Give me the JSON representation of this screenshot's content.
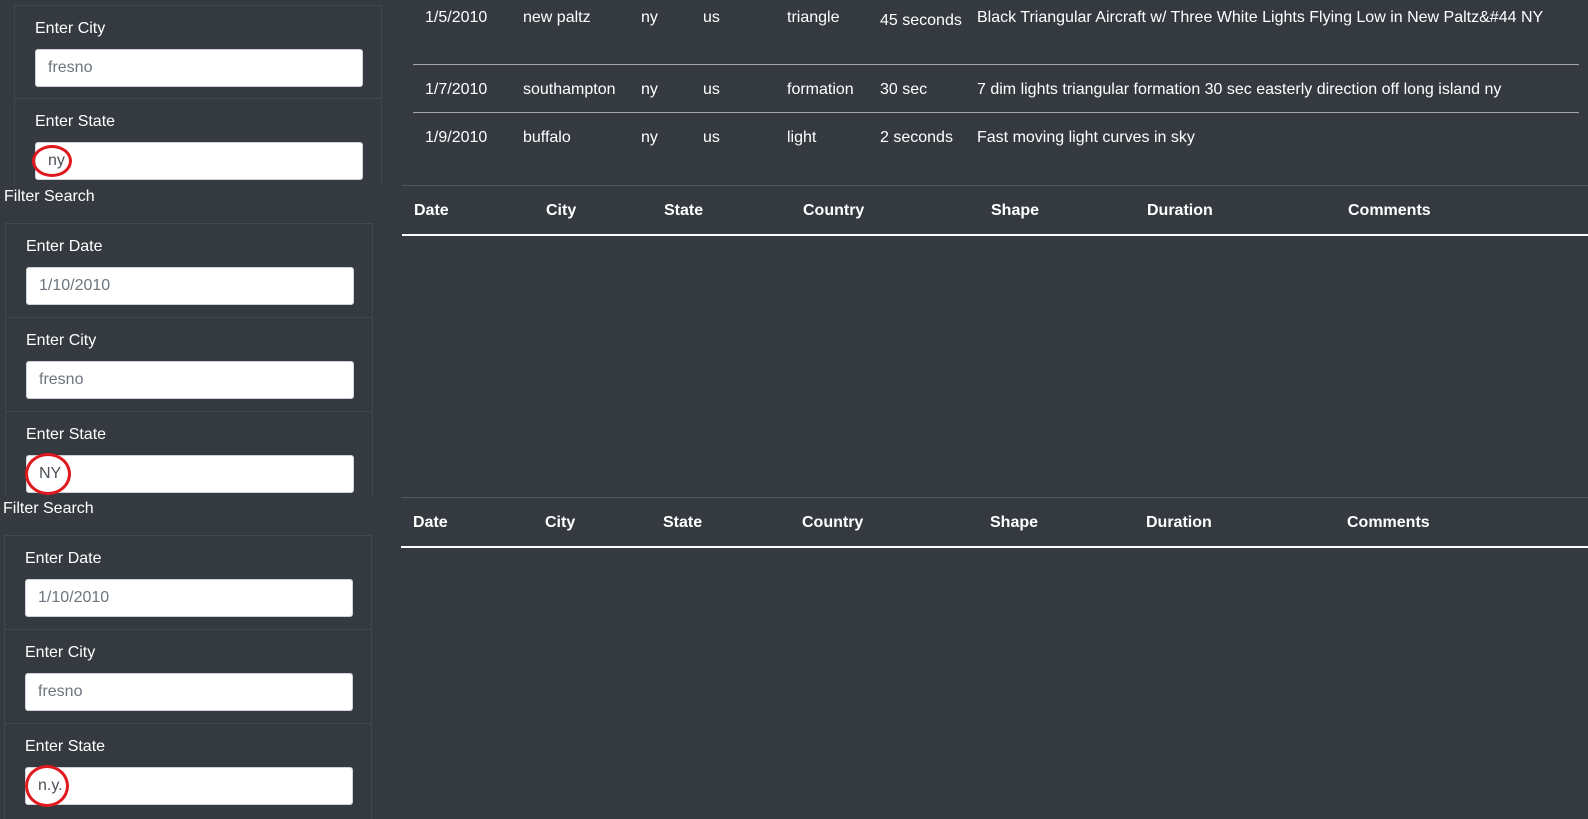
{
  "ufo_rows": [
    {
      "date": "1/5/2010",
      "city": "new paltz",
      "state": "ny",
      "country": "us",
      "shape": "triangle",
      "duration": "45 seconds",
      "comments": "Black Triangular Aircraft w/ Three White Lights Flying Low in New Paltz&#44 NY"
    },
    {
      "date": "1/7/2010",
      "city": "southampton",
      "state": "ny",
      "country": "us",
      "shape": "formation",
      "duration": "30 sec",
      "comments": "7 dim lights triangular formation 30 sec easterly direction off long island ny"
    },
    {
      "date": "1/9/2010",
      "city": "buffalo",
      "state": "ny",
      "country": "us",
      "shape": "light",
      "duration": "2 seconds",
      "comments": "Fast moving light curves in sky"
    }
  ],
  "table_headers": [
    "Date",
    "City",
    "State",
    "Country",
    "Shape",
    "Duration",
    "Comments"
  ],
  "panel1": {
    "city_label": "Enter City",
    "city_placeholder": "fresno",
    "state_label": "Enter State",
    "state_value": "ny"
  },
  "panel2": {
    "filter_title": "Filter Search",
    "date_label": "Enter Date",
    "date_placeholder": "1/10/2010",
    "city_label": "Enter City",
    "city_placeholder": "fresno",
    "state_label": "Enter State",
    "state_value": "NY"
  },
  "panel3": {
    "filter_title": "Filter Search",
    "date_label": "Enter Date",
    "date_placeholder": "1/10/2010",
    "city_label": "Enter City",
    "city_placeholder": "fresno",
    "state_label": "Enter State",
    "state_value": "n.y."
  },
  "colors": {
    "background": "#343a40",
    "marker": "#e0191f",
    "input_bg": "#ffffff"
  }
}
